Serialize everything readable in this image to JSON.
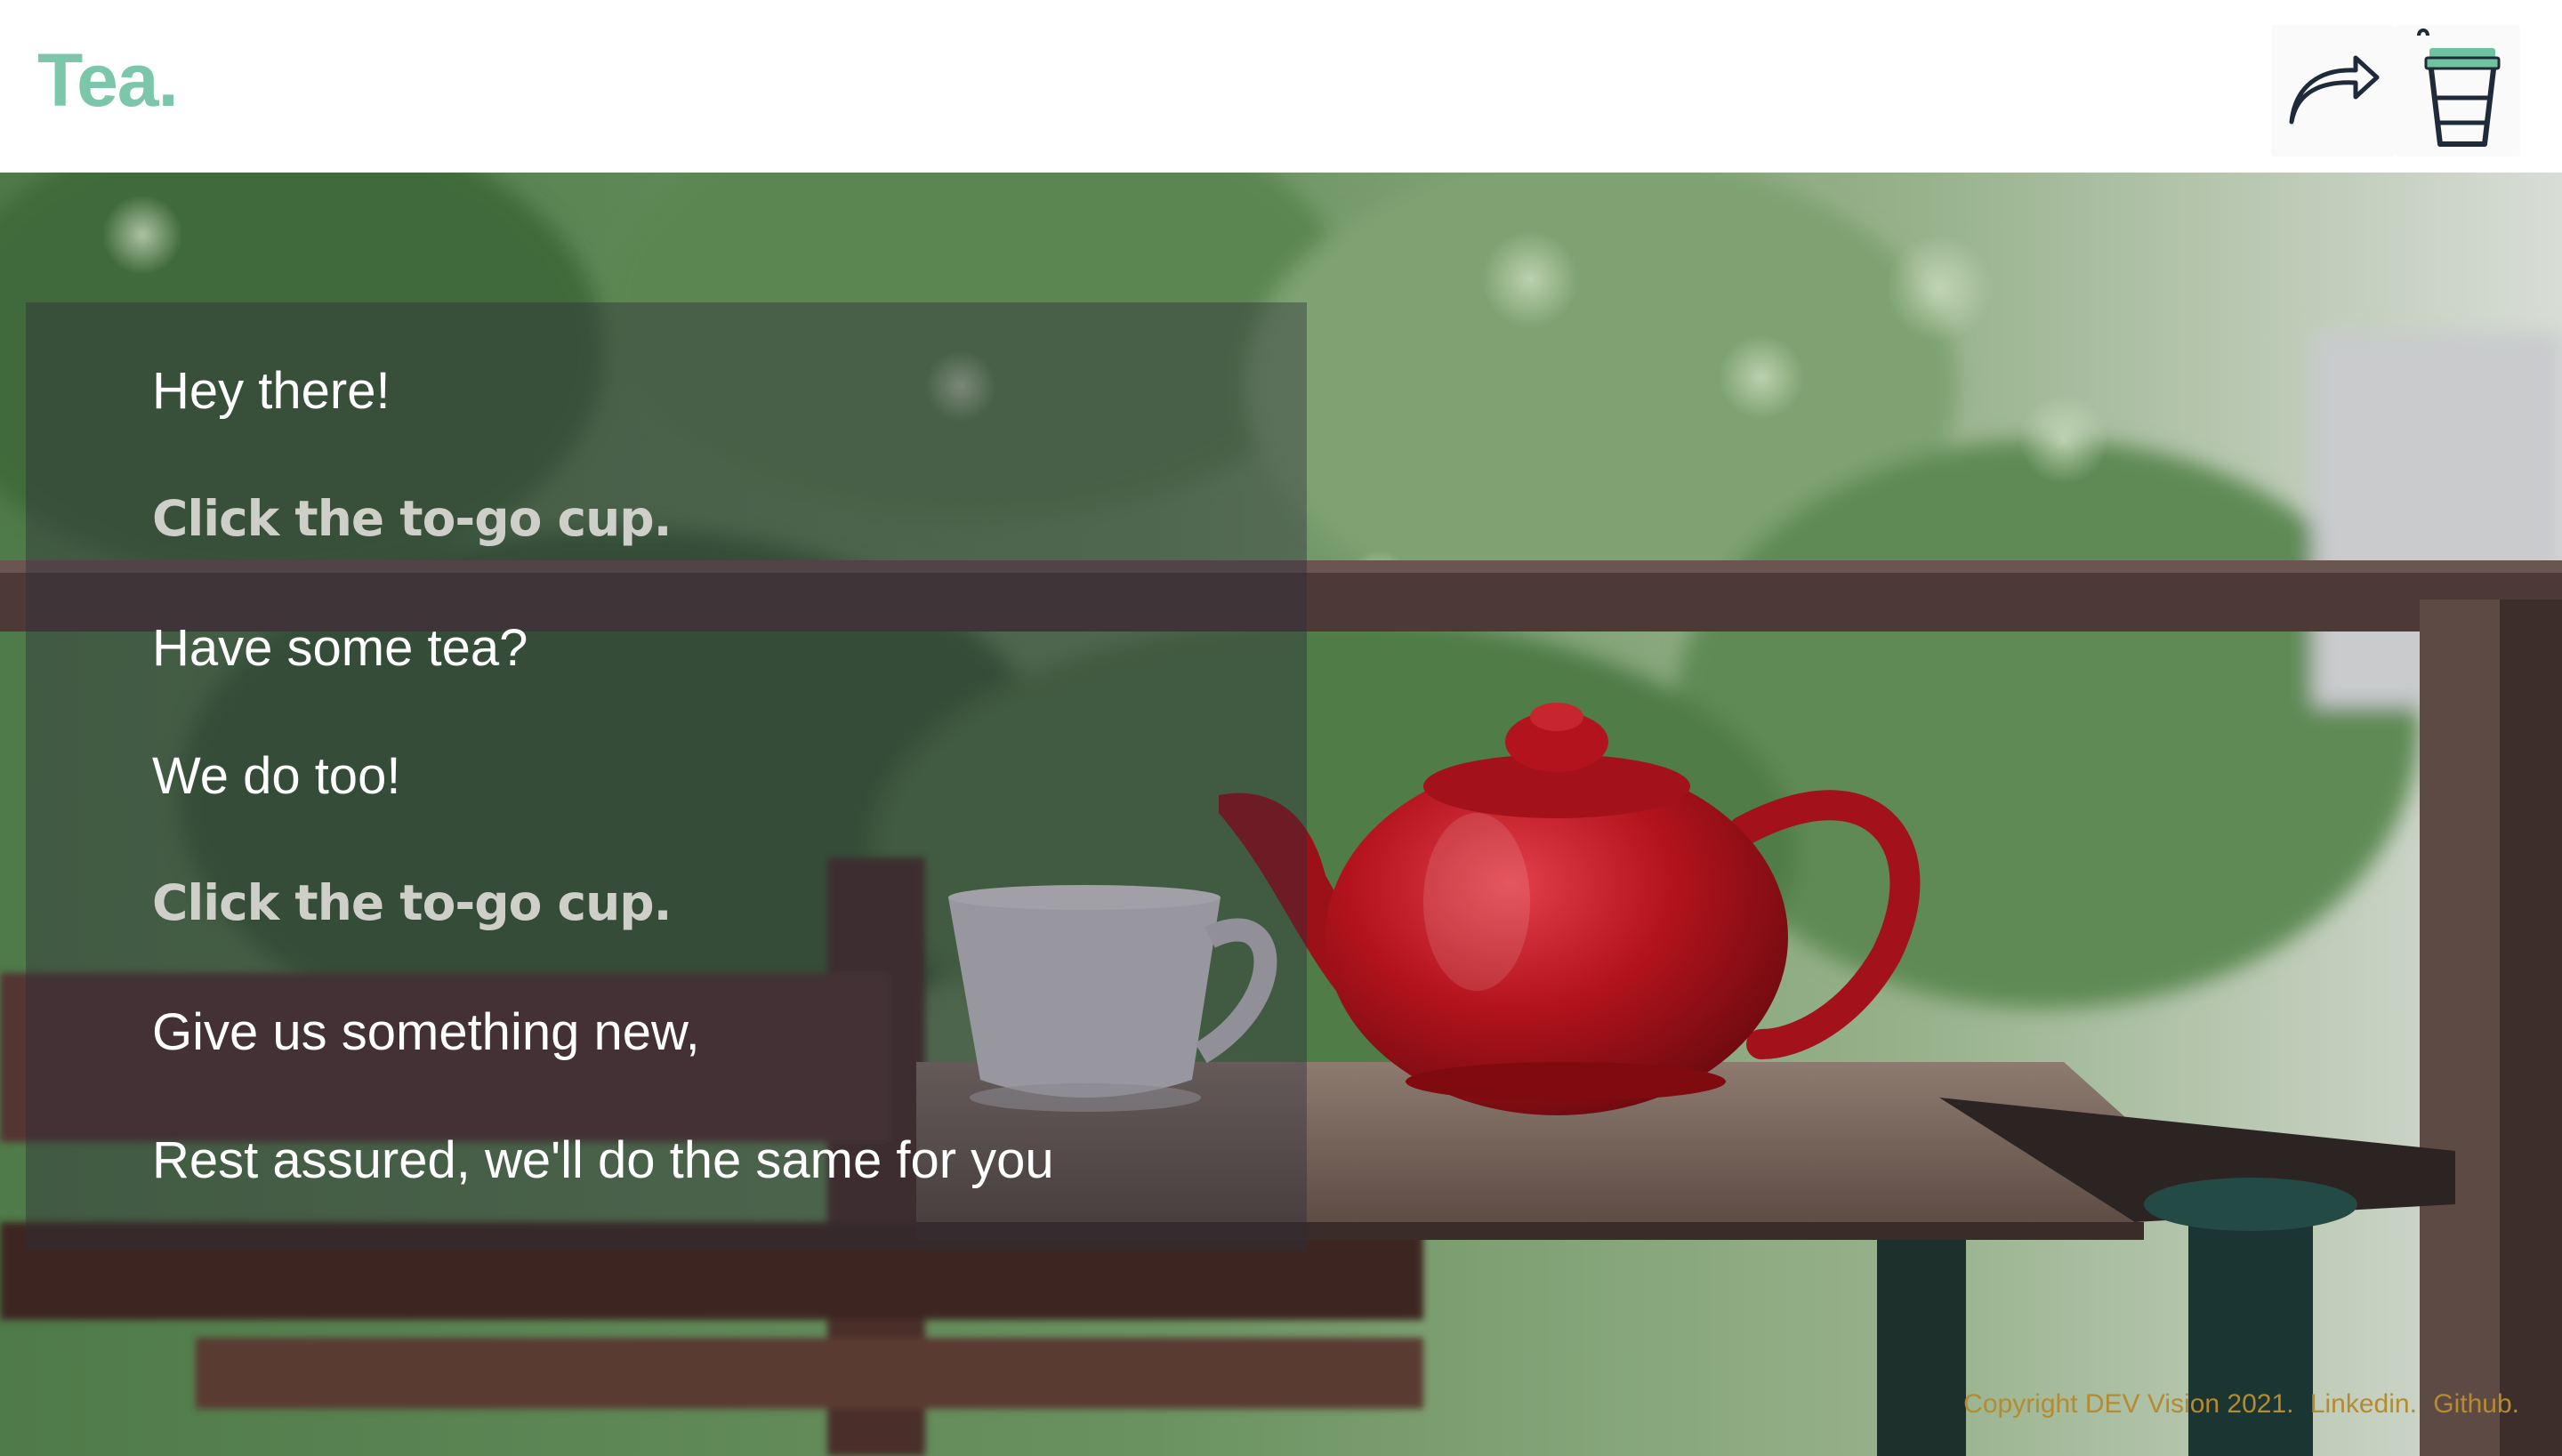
{
  "header": {
    "logo": "Tea.",
    "share_icon": "share-arrow-icon",
    "cup_icon": "to-go-cup-icon"
  },
  "panel": {
    "lines": [
      {
        "text": "Hey there!",
        "style": "normal"
      },
      {
        "text": "Click the to-go cup.",
        "style": "cta"
      },
      {
        "text": "Have some tea?",
        "style": "normal"
      },
      {
        "text": "We do too!",
        "style": "normal"
      },
      {
        "text": "Click the to-go cup.",
        "style": "cta"
      },
      {
        "text": "Give us something new,",
        "style": "normal"
      },
      {
        "text": "Rest assured, we'll do the same for you",
        "style": "normal"
      }
    ]
  },
  "footer": {
    "copyright": "Copyright DEV Vision 2021.",
    "linkedin": "Linkedin.",
    "github": "Github."
  },
  "colors": {
    "brand": "#7cc7a9",
    "footer_text": "#b58b2e",
    "panel_overlay": "rgba(45,45,58,0.42)",
    "teapot": "#b3131c"
  }
}
